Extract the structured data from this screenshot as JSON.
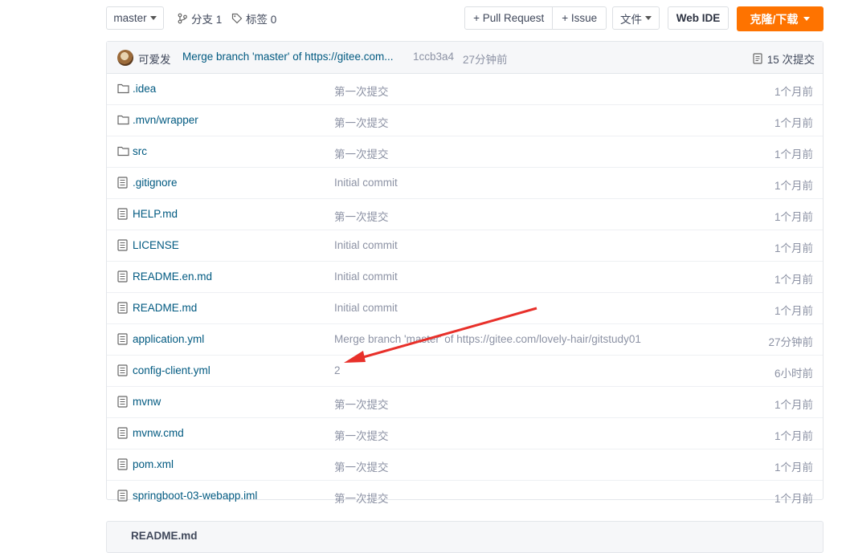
{
  "toolbar": {
    "branch_select": "master",
    "branches_label": "分支 1",
    "tags_label": "标签 0",
    "pull_request": "+ Pull Request",
    "issue": "+ Issue",
    "file_menu": "文件",
    "web_ide": "Web IDE",
    "clone": "克隆/下载"
  },
  "commit": {
    "author": "可爱发",
    "message": "Merge branch 'master' of https://gitee.com...",
    "sha": "1ccb3a4",
    "time": "27分钟前",
    "count": "15 次提交"
  },
  "files": [
    {
      "name": ".idea",
      "type": "folder",
      "message": "第一次提交",
      "time": "1个月前"
    },
    {
      "name": ".mvn/wrapper",
      "type": "folder",
      "message": "第一次提交",
      "time": "1个月前"
    },
    {
      "name": "src",
      "type": "folder",
      "message": "第一次提交",
      "time": "1个月前"
    },
    {
      "name": ".gitignore",
      "type": "file",
      "message": "Initial commit",
      "time": "1个月前"
    },
    {
      "name": "HELP.md",
      "type": "file",
      "message": "第一次提交",
      "time": "1个月前"
    },
    {
      "name": "LICENSE",
      "type": "file",
      "message": "Initial commit",
      "time": "1个月前"
    },
    {
      "name": "README.en.md",
      "type": "file",
      "message": "Initial commit",
      "time": "1个月前"
    },
    {
      "name": "README.md",
      "type": "file",
      "message": "Initial commit",
      "time": "1个月前"
    },
    {
      "name": "application.yml",
      "type": "file",
      "message": "Merge branch 'master' of https://gitee.com/lovely-hair/gitstudy01",
      "time": "27分钟前"
    },
    {
      "name": "config-client.yml",
      "type": "file",
      "message": "2",
      "time": "6小时前"
    },
    {
      "name": "mvnw",
      "type": "file",
      "message": "第一次提交",
      "time": "1个月前"
    },
    {
      "name": "mvnw.cmd",
      "type": "file",
      "message": "第一次提交",
      "time": "1个月前"
    },
    {
      "name": "pom.xml",
      "type": "file",
      "message": "第一次提交",
      "time": "1个月前"
    },
    {
      "name": "springboot-03-webapp.iml",
      "type": "file",
      "message": "第一次提交",
      "time": "1个月前"
    }
  ],
  "readme": {
    "title": "README.md"
  },
  "colors": {
    "accent": "#fe7300",
    "link": "#005980",
    "muted": "#8c92a4",
    "annotation_arrow": "#e8302a"
  }
}
